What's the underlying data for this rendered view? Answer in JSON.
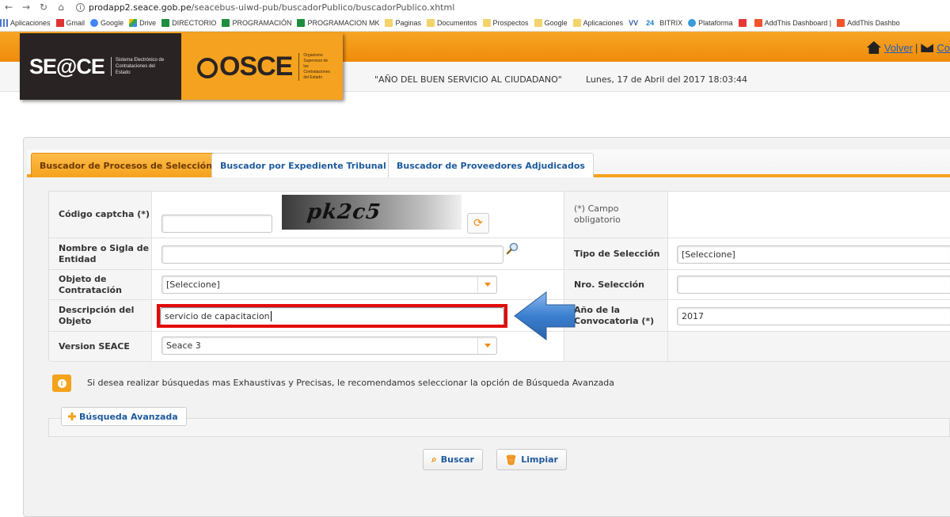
{
  "browser": {
    "url_host": "prodapp2.seace.gob.pe",
    "url_path": "/seacebus-uiwd-pub/buscadorPublico/buscadorPublico.xhtml",
    "bookmarks": [
      {
        "label": "Aplicaciones",
        "icon": "apps-icon"
      },
      {
        "label": "Gmail",
        "icon": "gmail-icon"
      },
      {
        "label": "Google",
        "icon": "google-icon"
      },
      {
        "label": "Drive",
        "icon": "drive-icon"
      },
      {
        "label": "DIRECTORIO",
        "icon": "sheets-icon"
      },
      {
        "label": "PROGRAMACIÓN",
        "icon": "sheets-icon"
      },
      {
        "label": "PROGRAMACION MK",
        "icon": "sheets-icon"
      },
      {
        "label": "Paginas",
        "icon": "folder-icon"
      },
      {
        "label": "Documentos",
        "icon": "folder-icon"
      },
      {
        "label": "Prospectos",
        "icon": "folder-icon"
      },
      {
        "label": "Google",
        "icon": "folder-icon"
      },
      {
        "label": "Aplicaciones",
        "icon": "folder-icon"
      },
      {
        "label": "",
        "icon": "vw-icon"
      },
      {
        "label": "BITRIX",
        "icon": "bitrix-icon"
      },
      {
        "label": "Plataforma",
        "icon": "plataforma-icon"
      },
      {
        "label": "",
        "icon": "flash-icon"
      },
      {
        "label": "AddThis Dashboard |",
        "icon": "addthis-icon"
      },
      {
        "label": "AddThis Dashbo",
        "icon": "addthis-icon"
      }
    ]
  },
  "header": {
    "seace_logo": "SE@CE",
    "seace_sub": "Sistema Electrónico de Contrataciones del Estado",
    "osce_logo": "OSCE",
    "osce_sub": "Organismo Supervisor de las Contrataciones del Estado",
    "motto": "\"AÑO DEL BUEN SERVICIO AL CIUDADANO\"",
    "datetime": "Lunes, 17 de Abril del 2017  18:03:44",
    "volver": "Volver",
    "separator": "|",
    "contact": "Co"
  },
  "tabs": [
    {
      "label": "Buscador de Procesos de Selección",
      "active": true
    },
    {
      "label": "Buscador por Expediente Tribunal",
      "active": false
    },
    {
      "label": "Buscador de Proveedores Adjudicados",
      "active": false
    }
  ],
  "form": {
    "captcha_label": "Código captcha (*)",
    "captcha_text": "pk2c5",
    "captcha_value": "",
    "required_note": "(*) Campo obligatorio",
    "entidad_label": "Nombre o Sigla de Entidad",
    "entidad_value": "",
    "tipo_label": "Tipo de Selección",
    "tipo_value": "[Seleccione]",
    "objeto_label": "Objeto de Contratación",
    "objeto_value": "[Seleccione]",
    "nro_label": "Nro. Selección",
    "nro_value": "",
    "descripcion_label": "Descripción del Objeto",
    "descripcion_value": "servicio de capacitacion",
    "anio_label": "Año de la Convocatoria (*)",
    "anio_value": "2017",
    "version_label": "Version SEACE",
    "version_value": "Seace 3"
  },
  "info_text": "Si desea realizar búsquedas mas Exhaustivas y Precisas, le recomendamos seleccionar la opción de Búsqueda Avanzada",
  "advanced_label": "Búsqueda Avanzada",
  "buttons": {
    "search": "Buscar",
    "clear": "Limpiar"
  },
  "colors": {
    "accent": "#f5a21c",
    "link": "#1d5a9c",
    "highlight": "#e30b0b",
    "arrow": "#3b7fd0"
  }
}
